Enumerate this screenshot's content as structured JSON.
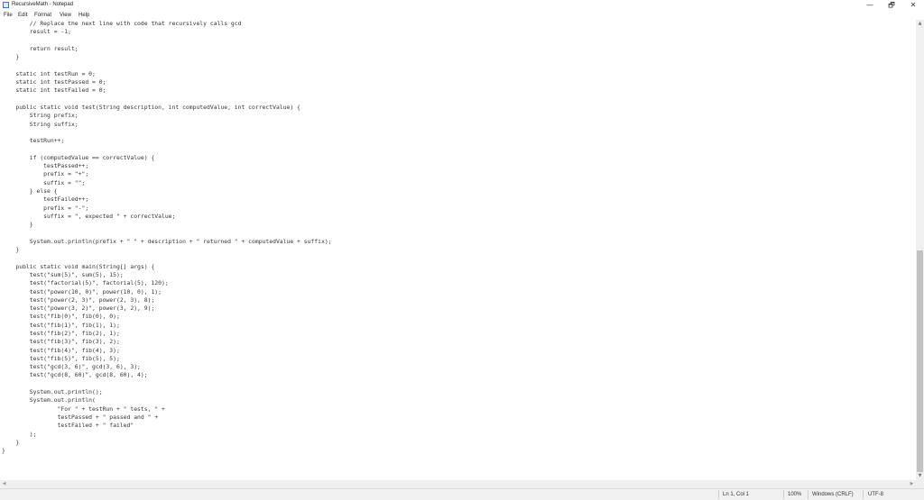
{
  "window": {
    "title": "RecursiveMath - Notepad",
    "minimize_glyph": "—",
    "restore_glyph": "🗗",
    "close_glyph": "✕"
  },
  "menu": [
    "File",
    "Edit",
    "Format",
    "View",
    "Help"
  ],
  "editor": {
    "lines": [
      "        // Replace the next line with code that recursively calls gcd",
      "        result = -1;",
      "",
      "        return result;",
      "    }",
      "",
      "    static int testRun = 0;",
      "    static int testPassed = 0;",
      "    static int testFailed = 0;",
      "",
      "    public static void test(String description, int computedValue, int correctValue) {",
      "        String prefix;",
      "        String suffix;",
      "",
      "        testRun++;",
      "",
      "        if (computedValue == correctValue) {",
      "            testPassed++;",
      "            prefix = \"+\";",
      "            suffix = \"\";",
      "        } else {",
      "            testFailed++;",
      "            prefix = \"-\";",
      "            suffix = \", expected \" + correctValue;",
      "        }",
      "",
      "        System.out.println(prefix + \" \" + description + \" returned \" + computedValue + suffix);",
      "    }",
      "",
      "    public static void main(String[] args) {",
      "        test(\"sum(5)\", sum(5), 15);",
      "        test(\"factorial(5)\", factorial(5), 120);",
      "        test(\"power(10, 0)\", power(10, 0), 1);",
      "        test(\"power(2, 3)\", power(2, 3), 8);",
      "        test(\"power(3, 2)\", power(3, 2), 9);",
      "        test(\"fib(0)\", fib(0), 0);",
      "        test(\"fib(1)\", fib(1), 1);",
      "        test(\"fib(2)\", fib(2), 1);",
      "        test(\"fib(3)\", fib(3), 2);",
      "        test(\"fib(4)\", fib(4), 3);",
      "        test(\"fib(5)\", fib(5), 5);",
      "        test(\"gcd(3, 6)\", gcd(3, 6), 3);",
      "        test(\"gcd(8, 60)\", gcd(8, 60), 4);",
      "",
      "        System.out.println();",
      "        System.out.println(",
      "                \"For \" + testRun + \" tests, \" +",
      "                testPassed + \" passed and \" +",
      "                testFailed + \" failed\"",
      "        );",
      "    }",
      "}"
    ]
  },
  "statusbar": {
    "position": "Ln 1, Col 1",
    "zoom": "100%",
    "line_ending": "Windows (CRLF)",
    "encoding": "UTF-8"
  }
}
